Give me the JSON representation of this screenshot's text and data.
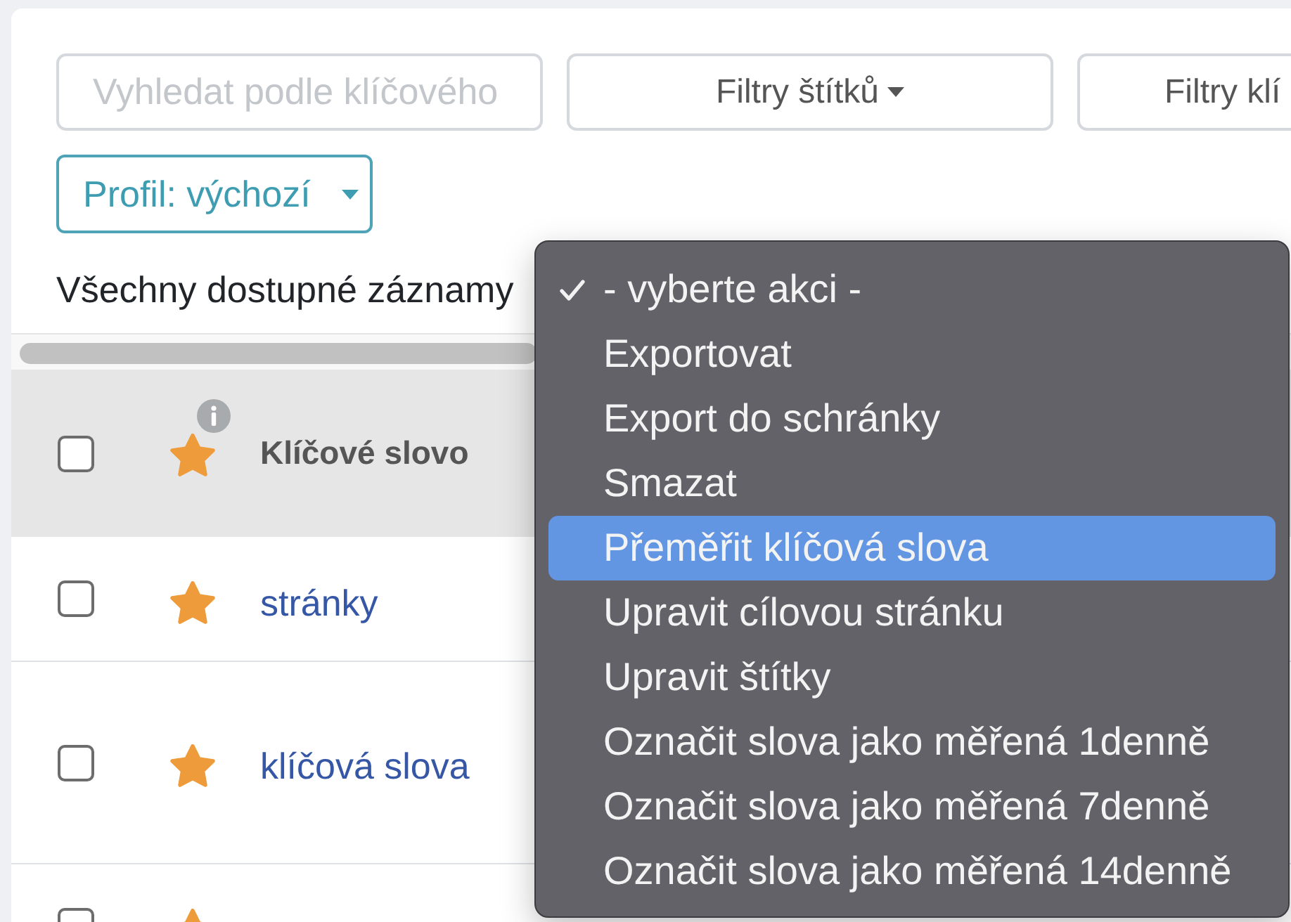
{
  "search": {
    "placeholder": "Vyhledat podle klíčového"
  },
  "filters": [
    {
      "label": "Filtry štítků",
      "dropdown": true
    },
    {
      "label": "Filtry klí",
      "dropdown": false
    }
  ],
  "profile": {
    "label": "Profil: výchozí"
  },
  "records_label": "Všechny dostupné záznamy",
  "table": {
    "header": {
      "checked": false,
      "column": "Klíčové slovo"
    },
    "rows": [
      {
        "checked": false,
        "starred": true,
        "keyword": "stránky"
      },
      {
        "checked": false,
        "starred": true,
        "keyword": "klíčová slova"
      },
      {
        "checked": false,
        "starred": true
      }
    ]
  },
  "action_menu": {
    "items": [
      {
        "label": "- vyberte akci -",
        "selected": true,
        "highlighted": false
      },
      {
        "label": "Exportovat",
        "selected": false,
        "highlighted": false
      },
      {
        "label": "Export do schránky",
        "selected": false,
        "highlighted": false
      },
      {
        "label": "Smazat",
        "selected": false,
        "highlighted": false
      },
      {
        "label": "Přeměřit klíčová slova",
        "selected": false,
        "highlighted": true
      },
      {
        "label": "Upravit cílovou stránku",
        "selected": false,
        "highlighted": false
      },
      {
        "label": "Upravit štítky",
        "selected": false,
        "highlighted": false
      },
      {
        "label": "Označit slova jako měřená 1denně",
        "selected": false,
        "highlighted": false
      },
      {
        "label": "Označit slova jako měřená 7denně",
        "selected": false,
        "highlighted": false
      },
      {
        "label": "Označit slova jako měřená 14denně",
        "selected": false,
        "highlighted": false
      }
    ]
  }
}
